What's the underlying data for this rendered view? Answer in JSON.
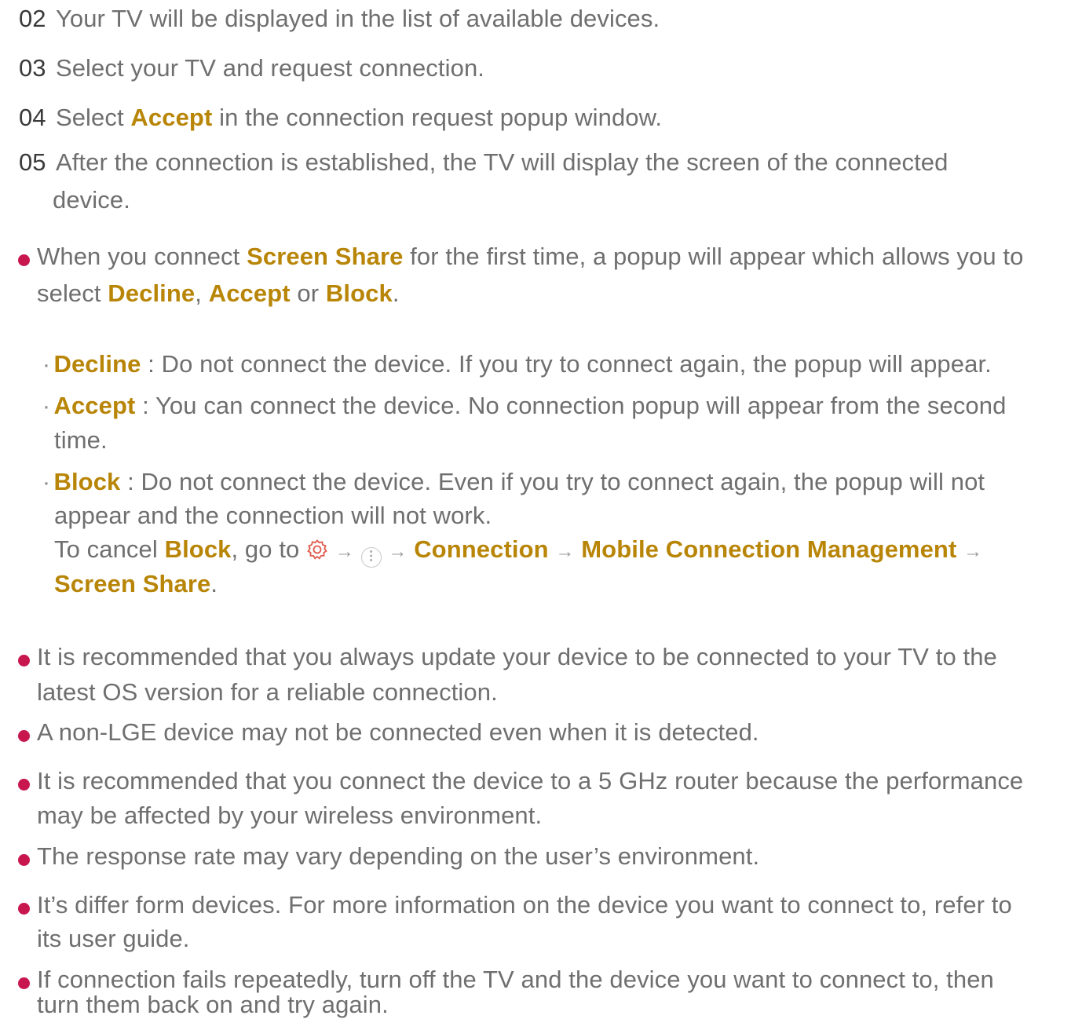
{
  "steps": [
    {
      "num": "02",
      "text": "Your TV will be displayed in the list of available devices."
    },
    {
      "num": "03",
      "text": "Select your TV and request connection."
    },
    {
      "num": "04",
      "pre": "Select ",
      "hl": "Accept",
      "post": " in the connection request popup window."
    },
    {
      "num": "05",
      "line1": "After the connection is established, the TV will display the screen of the connected",
      "line2": "device."
    }
  ],
  "note1": {
    "a": "When you connect ",
    "screen_share": "Screen Share",
    "b": " for the first time, a popup will appear which allows you to",
    "c": "select ",
    "decline": "Decline",
    "comma": ", ",
    "accept": "Accept",
    "or": " or ",
    "block": "Block",
    "period": "."
  },
  "options": [
    {
      "label": "Decline",
      "desc1": " : Do not connect the device. If you try to connect again, the popup will appear."
    },
    {
      "label": "Accept",
      "desc1": " : You can connect the device. No connection popup will appear from the second",
      "desc2": "time."
    },
    {
      "label": "Block",
      "desc1": " : Do not connect the device. Even if you try to connect again, the popup will not",
      "desc2": "appear and the connection will not work."
    }
  ],
  "cancel": {
    "pre": "To cancel ",
    "block": "Block",
    "mid": ", go to ",
    "arrow": "→",
    "connection": "Connection",
    "mobile": "Mobile Connection Management",
    "screen_share": "Screen Share",
    "end": ".",
    "more_glyph": "⋮",
    "icons": [
      "gear-icon",
      "more-icon",
      "arrow-icon"
    ]
  },
  "notes": [
    {
      "line1": "It is recommended that you always update your device to be connected to your TV to the",
      "line2": "latest OS version for a reliable connection."
    },
    {
      "line1": "A non-LGE device may not be connected even when it is detected."
    },
    {
      "line1": "It is recommended that you connect the device to a 5 GHz router because the performance",
      "line2": "may be affected by your wireless environment."
    },
    {
      "line1": "The response rate may vary depending on the user’s environment."
    },
    {
      "line1": "It’s differ form devices. For more information on the device you want to connect to, refer to",
      "line2": "its user guide."
    },
    {
      "line1": "If connection fails repeatedly, turn off the TV and the device you want to connect to, then",
      "line2": "turn them back on and try again."
    }
  ],
  "colors": {
    "highlight": "#b88507",
    "bullet": "#c8174f",
    "text": "#6f6f6f",
    "gear": "#e05a4a"
  }
}
